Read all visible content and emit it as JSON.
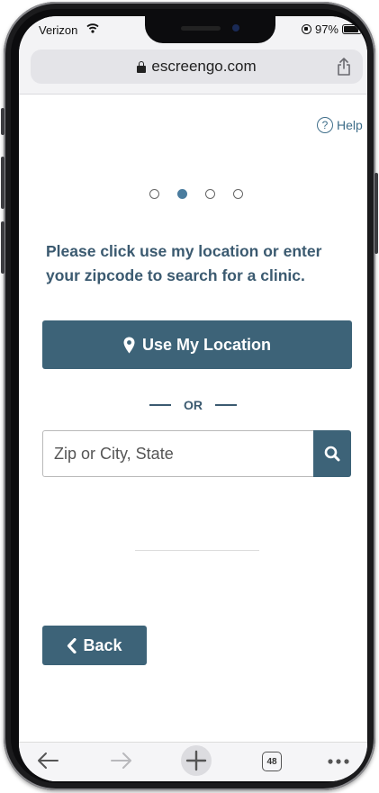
{
  "status_bar": {
    "carrier": "Verizon",
    "battery_text": "97%",
    "battery_level": 0.97
  },
  "browser": {
    "url": "escreengo.com",
    "tab_count": "48"
  },
  "page": {
    "help_label": "Help",
    "help_glyph": "?",
    "step_total": 4,
    "step_current": 2,
    "prompt": "Please click use my location or enter your zipcode to search for a clinic.",
    "use_location_label": "Use My Location",
    "or_label": "OR",
    "search": {
      "placeholder": "Zip or City, State",
      "value": ""
    },
    "back_label": "Back"
  },
  "colors": {
    "accent": "#3d6378",
    "text": "#3b5a70",
    "link": "#3f6e8a",
    "active_dot": "#4a7c9e"
  },
  "icons": [
    "wifi-icon",
    "lock-icon",
    "share-icon",
    "question-icon",
    "map-pin-icon",
    "search-icon",
    "chevron-left-icon",
    "back-arrow-icon",
    "forward-arrow-icon",
    "plus-icon",
    "tabs-icon",
    "more-icon"
  ]
}
